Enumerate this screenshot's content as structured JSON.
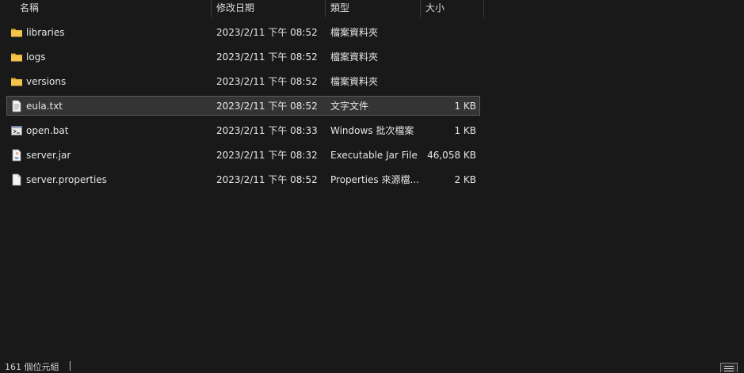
{
  "columns": {
    "name": "名稱",
    "date": "修改日期",
    "type": "類型",
    "size": "大小"
  },
  "files": [
    {
      "name": "libraries",
      "date": "2023/2/11 下午 08:52",
      "type": "檔案資料夾",
      "size": "",
      "icon": "folder-icon",
      "selected": false
    },
    {
      "name": "logs",
      "date": "2023/2/11 下午 08:52",
      "type": "檔案資料夾",
      "size": "",
      "icon": "folder-icon",
      "selected": false
    },
    {
      "name": "versions",
      "date": "2023/2/11 下午 08:52",
      "type": "檔案資料夾",
      "size": "",
      "icon": "folder-icon",
      "selected": false
    },
    {
      "name": "eula.txt",
      "date": "2023/2/11 下午 08:52",
      "type": "文字文件",
      "size": "1 KB",
      "icon": "text-file-icon",
      "selected": true
    },
    {
      "name": "open.bat",
      "date": "2023/2/11 下午 08:33",
      "type": "Windows 批次檔案",
      "size": "1 KB",
      "icon": "batch-file-icon",
      "selected": false
    },
    {
      "name": "server.jar",
      "date": "2023/2/11 下午 08:32",
      "type": "Executable Jar File",
      "size": "46,058 KB",
      "icon": "java-jar-icon",
      "selected": false
    },
    {
      "name": "server.properties",
      "date": "2023/2/11 下午 08:52",
      "type": "Properties 來源檔...",
      "size": "2 KB",
      "icon": "file-icon",
      "selected": false
    }
  ],
  "status": {
    "item_count": "161 個位元組"
  },
  "colors": {
    "background": "#191919",
    "selected_row": "#343434",
    "folder": "#f3c34a"
  }
}
